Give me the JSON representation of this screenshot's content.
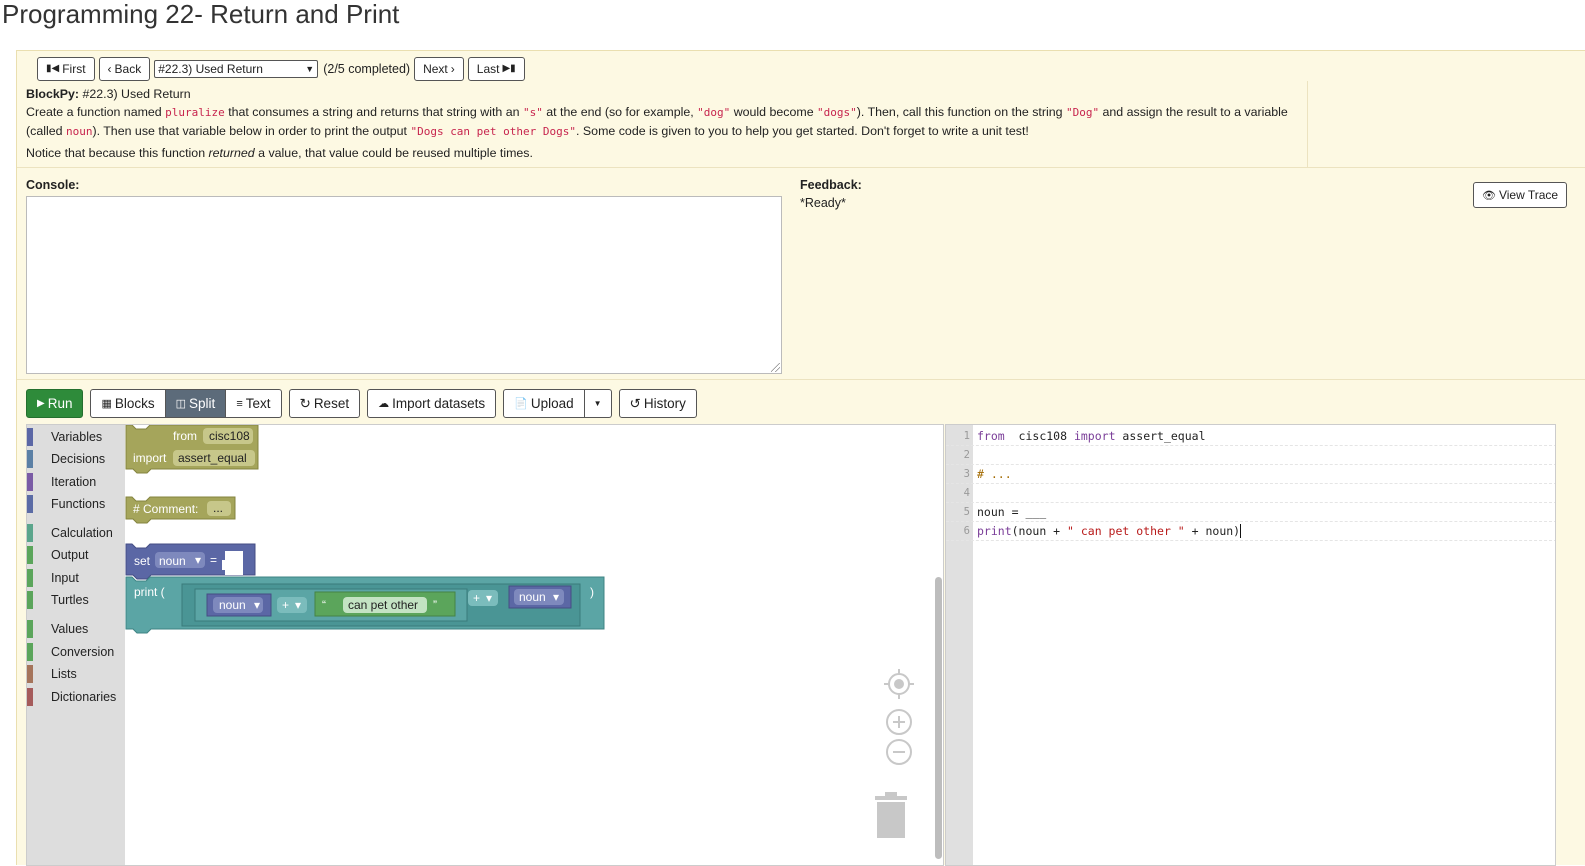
{
  "page": {
    "title": "Programming 22- Return and Print"
  },
  "nav": {
    "first": "First",
    "back": "Back",
    "select_value": "#22.3) Used Return",
    "progress": "(2/5 completed)",
    "next": "Next",
    "last": "Last"
  },
  "instructions": {
    "header_bold": "BlockPy:",
    "header_rest": " #22.3) Used Return",
    "seg": [
      "Create a function named ",
      "pluralize",
      " that consumes a string and returns that string with an ",
      "\"s\"",
      " at the end (so for example, ",
      "\"dog\"",
      " would become ",
      "\"dogs\"",
      "). Then, call this function on the string ",
      "\"Dog\"",
      " and assign the result to a variable (called ",
      "noun",
      "). Then use that variable below in order to print the output ",
      "\"Dogs can pet other Dogs\"",
      ". Some code is given to you to help you get started. Don't forget to write a unit test!"
    ],
    "note_pre": "Notice that because this function ",
    "note_em": "returned",
    "note_post": " a value, that value could be reused multiple times."
  },
  "console": {
    "label": "Console:"
  },
  "feedback": {
    "label": "Feedback:",
    "status": "*Ready*",
    "view_trace": "View Trace"
  },
  "toolbar": {
    "run": "Run",
    "blocks": "Blocks",
    "split": "Split",
    "text": "Text",
    "reset": "Reset",
    "import_datasets": "Import datasets",
    "upload": "Upload",
    "history": "History"
  },
  "toolbox": {
    "categories": [
      {
        "label": "Variables",
        "color": "#5b67a5"
      },
      {
        "label": "Decisions",
        "color": "#5b80a5"
      },
      {
        "label": "Iteration",
        "color": "#7a5ba5"
      },
      {
        "label": "Functions",
        "color": "#5b6ba5"
      },
      {
        "label": "Calculation",
        "color": "#5ba58c"
      },
      {
        "label": "Output",
        "color": "#5ba55b"
      },
      {
        "label": "Input",
        "color": "#5ba55b"
      },
      {
        "label": "Turtles",
        "color": "#5ba55b"
      },
      {
        "label": "Values",
        "color": "#5ba55b"
      },
      {
        "label": "Conversion",
        "color": "#5ba55b"
      },
      {
        "label": "Lists",
        "color": "#a5745b"
      },
      {
        "label": "Dictionaries",
        "color": "#a55b5b"
      }
    ]
  },
  "blocks": {
    "import_from": "from",
    "import_module": "cisc108",
    "import_kw": "import",
    "import_name": "assert_equal",
    "comment_label": "# Comment:",
    "comment_value": "...",
    "set_kw": "set",
    "set_var": "noun",
    "set_eq": "=",
    "print_kw": "print (",
    "print_close": ")",
    "print_var1": "noun",
    "print_op1": "+",
    "print_str": "can pet other",
    "print_op2": "+",
    "print_var2": "noun",
    "open_quote": "“",
    "close_quote": "”",
    "colors": {
      "import": "#a5a55b",
      "set": "#5b67a5",
      "print": "#5ba5a5",
      "string": "#5ba55b"
    }
  },
  "editor": {
    "lines": [
      {
        "n": "1",
        "parts": [
          [
            "kw",
            "from"
          ],
          [
            "",
            "  cisc108 "
          ],
          [
            "kw",
            "import"
          ],
          [
            "",
            " assert_equal"
          ]
        ]
      },
      {
        "n": "2",
        "parts": []
      },
      {
        "n": "3",
        "parts": [
          [
            "cm",
            "# ..."
          ]
        ]
      },
      {
        "n": "4",
        "parts": []
      },
      {
        "n": "5",
        "parts": [
          [
            "",
            "noun = ___"
          ]
        ]
      },
      {
        "n": "6",
        "parts": [
          [
            "kw",
            "print"
          ],
          [
            "",
            "(noun + "
          ],
          [
            "str",
            "\" can pet other \""
          ],
          [
            "",
            " + noun)"
          ]
        ]
      }
    ]
  }
}
